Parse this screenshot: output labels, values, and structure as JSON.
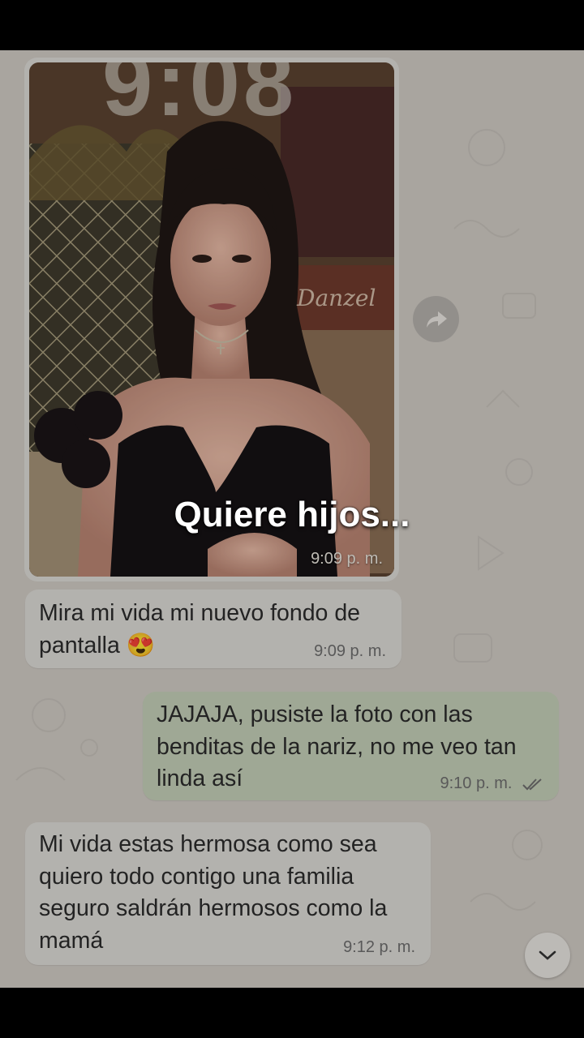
{
  "caption": "Quiere hijos...",
  "photo_message": {
    "clock_text": "9:08",
    "time": "9:09 p. m.",
    "sign_text": "Danzel"
  },
  "messages": [
    {
      "direction": "incoming",
      "text": "Mira mi vida mi nuevo fondo de pantalla 😍",
      "line1": "Mira mi vida mi nuevo fondo de",
      "line2": "pantalla 😍",
      "time": "9:09 p. m."
    },
    {
      "direction": "outgoing",
      "line1": "JAJAJA, pusiste la foto con las",
      "line2": "benditas de la nariz, no me veo tan",
      "line3": "linda así",
      "time": "9:10 p. m.",
      "status": "read"
    },
    {
      "direction": "incoming",
      "line1": "Mi vida estas hermosa como sea",
      "line2": "quiero todo contigo una familia",
      "line3": "seguro saldrán hermosos como la",
      "line4": "mamá",
      "time": "9:12 p. m."
    }
  ],
  "icons": {
    "forward": "forward-arrow-icon",
    "scroll_down": "chevron-down-icon",
    "read_receipt": "double-check-icon"
  },
  "colors": {
    "chat_background": "#cfcac3",
    "incoming_bubble": "#dbd9d5",
    "outgoing_bubble": "#c3cdb6",
    "read_ticks": "#6d6d6d"
  }
}
